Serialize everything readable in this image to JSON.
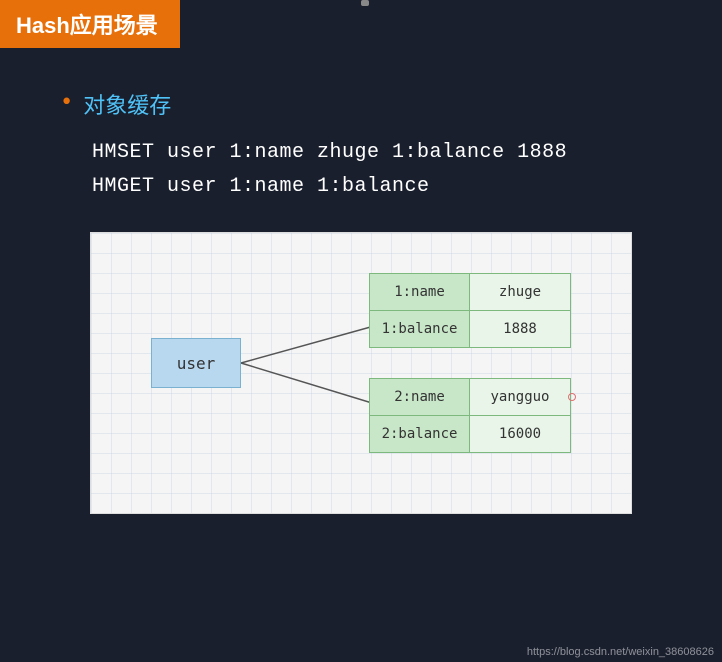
{
  "header": {
    "title": "Hash应用场景",
    "bg_color": "#e8700a"
  },
  "content": {
    "bullet_label": "对象缓存",
    "commands": [
      "HMSET  user  1:name  zhuge  1:balance  1888",
      "HMGET  user  1:name  1:balance"
    ]
  },
  "diagram": {
    "user_label": "user",
    "table_top": [
      {
        "key": "1:name",
        "value": "zhuge"
      },
      {
        "key": "1:balance",
        "value": "1888"
      }
    ],
    "table_bottom": [
      {
        "key": "2:name",
        "value": "yangguo"
      },
      {
        "key": "2:balance",
        "value": "16000"
      }
    ]
  },
  "watermark": "https://blog.csdn.net/weixin_38608626"
}
